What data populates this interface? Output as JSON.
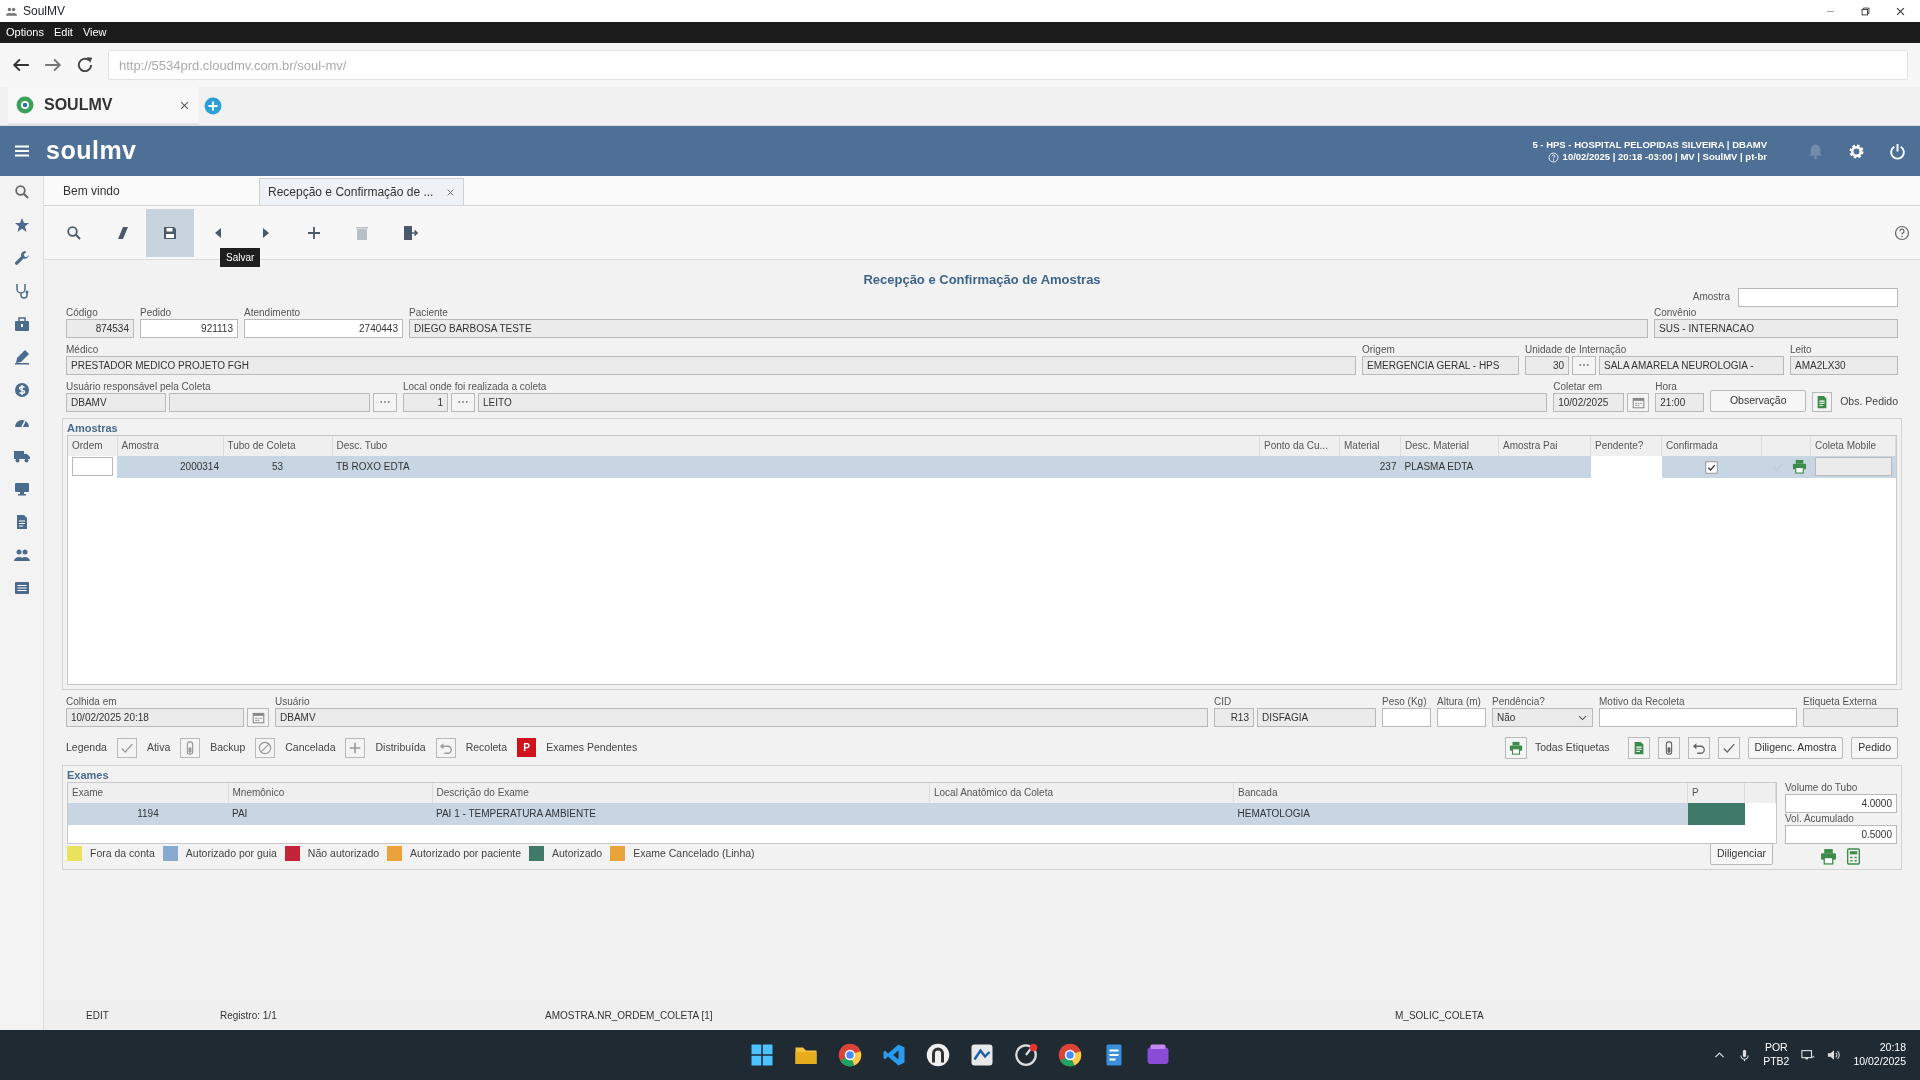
{
  "window": {
    "title": "SoulMV"
  },
  "menu": [
    "Options",
    "Edit",
    "View"
  ],
  "address_bar": {
    "url": "http://5534prd.cloudmv.com.br/soul-mv/"
  },
  "browser_tabs": [
    {
      "label": "SOULMV",
      "selected": true
    }
  ],
  "app_header": {
    "logo": "soulmv",
    "context": "5 - HPS - HOSPITAL PELOPIDAS SILVEIRA | DBAMV",
    "session": "10/02/2025 | 20:18 -03:00 | MV | SoulMV | pt-br"
  },
  "doc_tabs": [
    {
      "label": "Bem vindo",
      "selected": false,
      "closable": false
    },
    {
      "label": "Recepção e Confirmação de ...",
      "selected": true,
      "closable": true
    }
  ],
  "toolbar": {
    "tooltip": "Salvar",
    "buttons": [
      {
        "kind": "search",
        "selected": false,
        "disabled": false
      },
      {
        "kind": "clear",
        "selected": false,
        "disabled": false
      },
      {
        "kind": "save",
        "selected": true,
        "disabled": false
      },
      {
        "kind": "previous",
        "selected": false,
        "disabled": false
      },
      {
        "kind": "next",
        "selected": false,
        "disabled": false
      },
      {
        "kind": "add",
        "selected": false,
        "disabled": false
      },
      {
        "kind": "delete",
        "selected": false,
        "disabled": true
      },
      {
        "kind": "exit",
        "selected": false,
        "disabled": false
      }
    ]
  },
  "form": {
    "title": "Recepção e Confirmação de Amostras",
    "sample": {
      "label": "Amostra"
    },
    "lines": [
      {
        "fields": [
          {
            "label": "Código",
            "inputs": [
              {
                "kind": "number",
                "value": "874534",
                "readonly": true
              }
            ]
          },
          {
            "label": "Pedido",
            "inputs": [
              {
                "kind": "number",
                "value": "921113",
                "readonly": false
              }
            ]
          },
          {
            "label": "Atendimento",
            "inputs": [
              {
                "kind": "number",
                "value": "2740443",
                "readonly": false
              }
            ]
          },
          {
            "label": "Paciente",
            "inputs": [
              {
                "kind": "text",
                "value": "DIEGO BARBOSA TESTE",
                "readonly": true
              }
            ]
          },
          {
            "label": "Convênio",
            "inputs": [
              {
                "kind": "text",
                "value": "SUS - INTERNACAO",
                "readonly": true
              }
            ]
          }
        ]
      },
      {
        "fields": [
          {
            "label": "Médico",
            "inputs": [
              {
                "kind": "text",
                "value": "PRESTADOR MEDICO PROJETO FGH",
                "readonly": true
              }
            ]
          },
          {
            "label": "Origem",
            "inputs": [
              {
                "kind": "text",
                "value": "EMERGENCIA GERAL - HPS",
                "readonly": true
              }
            ]
          },
          {
            "label": "Unidade de Internação",
            "inputs": [
              {
                "kind": "number",
                "value": "30",
                "readonly": true
              },
              {
                "kind": "lookup"
              },
              {
                "kind": "text",
                "value": "SALA AMARELA NEUROLOGIA -",
                "readonly": true
              }
            ]
          },
          {
            "label": "Leito",
            "inputs": [
              {
                "kind": "text",
                "value": "AMA2LX30",
                "readonly": true
              }
            ]
          }
        ]
      },
      {
        "fields": [
          {
            "label": "Usuário responsável pela Coleta",
            "inputs": [
              {
                "kind": "text",
                "value": "DBAMV",
                "readonly": true
              },
              {
                "kind": "text",
                "readonly": true
              },
              {
                "kind": "lookup"
              }
            ]
          },
          {
            "label": "Local onde foi realizada a coleta",
            "inputs": [
              {
                "kind": "number",
                "value": "1",
                "readonly": true
              },
              {
                "kind": "lookup"
              },
              {
                "kind": "text",
                "value": "LEITO",
                "readonly": true
              }
            ]
          },
          {
            "label": "Coletar em",
            "inputs": [
              {
                "kind": "text",
                "value": "10/02/2025",
                "readonly": true
              },
              {
                "kind": "calendar"
              }
            ]
          },
          {
            "label": "Hora",
            "inputs": [
              {
                "kind": "text",
                "value": "21:00",
                "readonly": true
              }
            ]
          },
          {
            "inputs": [
              {
                "kind": "button",
                "label": "Observação"
              }
            ]
          },
          {
            "inputs": [
              {
                "kind": "doc-link",
                "label": "Obs. Pedido"
              }
            ]
          }
        ]
      }
    ]
  },
  "samples": {
    "title": "Amostras",
    "columns": [
      "Ordem",
      "Amostra",
      "Tubo de Coleta",
      "Desc. Tubo",
      "Ponto da Cu...",
      "Material",
      "Desc. Material",
      "Amostra Pai",
      "Pendente?",
      "Confirmada",
      "Coleta Mobile"
    ],
    "rows": [
      {
        "selected": true,
        "amostra": "2000314",
        "tubo": "53",
        "desc_tubo": "TB ROXO EDTA",
        "material": "237",
        "desc_material": "PLASMA EDTA",
        "confirmada": true
      }
    ]
  },
  "details": [
    {
      "label": "Colhida em",
      "inputs": [
        {
          "kind": "text",
          "value": "10/02/2025 20:18",
          "readonly": true
        },
        {
          "kind": "calendar"
        }
      ]
    },
    {
      "label": "Usuário",
      "inputs": [
        {
          "kind": "text",
          "value": "DBAMV",
          "readonly": true
        }
      ]
    },
    {
      "label": "CID",
      "inputs": [
        {
          "kind": "number",
          "value": "R13",
          "readonly": true
        },
        {
          "kind": "text",
          "value": "DISFAGIA",
          "readonly": true
        }
      ]
    },
    {
      "label": "Peso (Kg)",
      "inputs": [
        {
          "kind": "text",
          "readonly": false
        }
      ]
    },
    {
      "label": "Altura (m)",
      "inputs": [
        {
          "kind": "text",
          "readonly": false
        }
      ]
    },
    {
      "label": "Pendência?",
      "inputs": [
        {
          "kind": "select",
          "value": "Não"
        }
      ]
    },
    {
      "label": "Motivo da Recoleta",
      "inputs": [
        {
          "kind": "text",
          "readonly": false
        }
      ]
    },
    {
      "label": "Etiqueta Externa",
      "inputs": [
        {
          "kind": "text",
          "readonly": true
        }
      ]
    }
  ],
  "legend": {
    "title": "Legenda",
    "items": [
      {
        "kind": "check",
        "label": "Ativa"
      },
      {
        "kind": "tube",
        "label": "Backup"
      },
      {
        "kind": "cancel",
        "label": "Cancelada"
      },
      {
        "kind": "plus",
        "label": "Distribuída"
      },
      {
        "kind": "undo",
        "label": "Recoleta"
      },
      {
        "kind": "pending",
        "mark": "P",
        "label": "Exames Pendentes"
      }
    ]
  },
  "actions": [
    {
      "kind": "print",
      "label": "Todas Etiquetas"
    },
    {
      "kind": "doc"
    },
    {
      "kind": "tube"
    },
    {
      "kind": "undo"
    },
    {
      "kind": "check"
    },
    {
      "kind": "button",
      "label": "Diligenc. Amostra"
    },
    {
      "kind": "button",
      "label": "Pedido"
    }
  ],
  "exams": {
    "title": "Exames",
    "columns": [
      "Exame",
      "Mnemônico",
      "Descrição do Exame",
      "Local Anatômico da Coleta",
      "Bancada",
      "P"
    ],
    "rows": [
      {
        "selected": true,
        "exame": "1194",
        "mnemonico": "PAI",
        "descricao": "PAI 1 - TEMPERATURA AMBIENTE",
        "bancada": "HEMATOLOGIA",
        "color": "#3f7a68"
      }
    ],
    "volumes": [
      {
        "label": "Volume do Tubo",
        "value": "4.0000"
      },
      {
        "label": "Vol. Acumulado",
        "value": "0.5000"
      }
    ],
    "legend": [
      {
        "label": "Fora da conta",
        "color": "#e8e25c"
      },
      {
        "label": "Autorizado por guia",
        "color": "#86aad0"
      },
      {
        "label": "Não autorizado",
        "color": "#c4243a"
      },
      {
        "label": "Autorizado por paciente",
        "color": "#e9a33a"
      },
      {
        "label": "Autorizado",
        "color": "#3f7a68"
      },
      {
        "label": "Exame Cancelado (Linha)",
        "color": "#e9a33a"
      }
    ],
    "button": "Diligenciar"
  },
  "status_bar": [
    "EDIT",
    "Registro: 1/1",
    "AMOSTRA.NR_ORDEM_COLETA [1]",
    "M_SOLIC_COLETA"
  ],
  "taskbar": {
    "language": "POR",
    "layout": "PTB2",
    "time": "20:18",
    "date": "10/02/2025"
  }
}
